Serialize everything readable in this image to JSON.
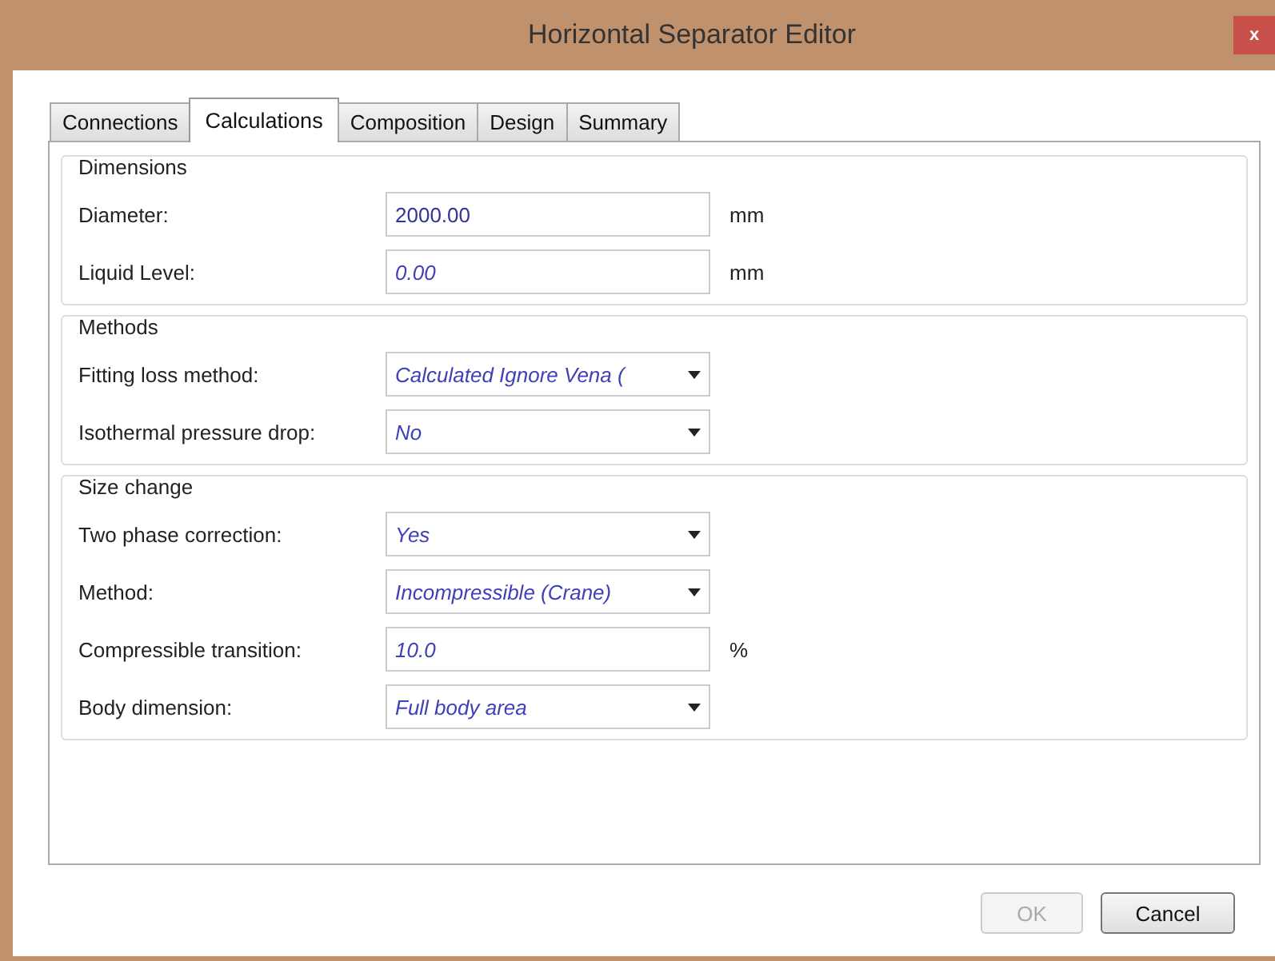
{
  "window": {
    "title": "Horizontal Separator Editor",
    "close": "x"
  },
  "tabs": [
    {
      "label": "Connections",
      "selected": false
    },
    {
      "label": "Calculations",
      "selected": true
    },
    {
      "label": "Composition",
      "selected": false
    },
    {
      "label": "Design",
      "selected": false
    },
    {
      "label": "Summary",
      "selected": false
    }
  ],
  "groups": [
    {
      "title": "Dimensions",
      "fields": [
        {
          "kind": "input",
          "label": "Diameter:",
          "value": "2000.00",
          "calculated": false,
          "unit": "mm"
        },
        {
          "kind": "input",
          "label": "Liquid Level:",
          "value": "0.00",
          "calculated": true,
          "unit": "mm"
        }
      ]
    },
    {
      "title": "Methods",
      "fields": [
        {
          "kind": "dropdown",
          "label": "Fitting loss method:",
          "value": "Calculated Ignore Vena (",
          "calculated": true
        },
        {
          "kind": "dropdown",
          "label": "Isothermal pressure drop:",
          "value": "No",
          "calculated": true
        }
      ]
    },
    {
      "title": "Size change",
      "fields": [
        {
          "kind": "dropdown",
          "label": "Two phase correction:",
          "value": "Yes",
          "calculated": true
        },
        {
          "kind": "dropdown",
          "label": "Method:",
          "value": "Incompressible (Crane)",
          "calculated": true
        },
        {
          "kind": "input",
          "label": "Compressible transition:",
          "value": "10.0",
          "calculated": true,
          "unit": "%"
        },
        {
          "kind": "dropdown",
          "label": "Body dimension:",
          "value": "Full body area",
          "calculated": true
        }
      ]
    }
  ],
  "buttons": [
    {
      "label": "OK",
      "disabled": true
    },
    {
      "label": "Cancel",
      "disabled": false
    }
  ]
}
